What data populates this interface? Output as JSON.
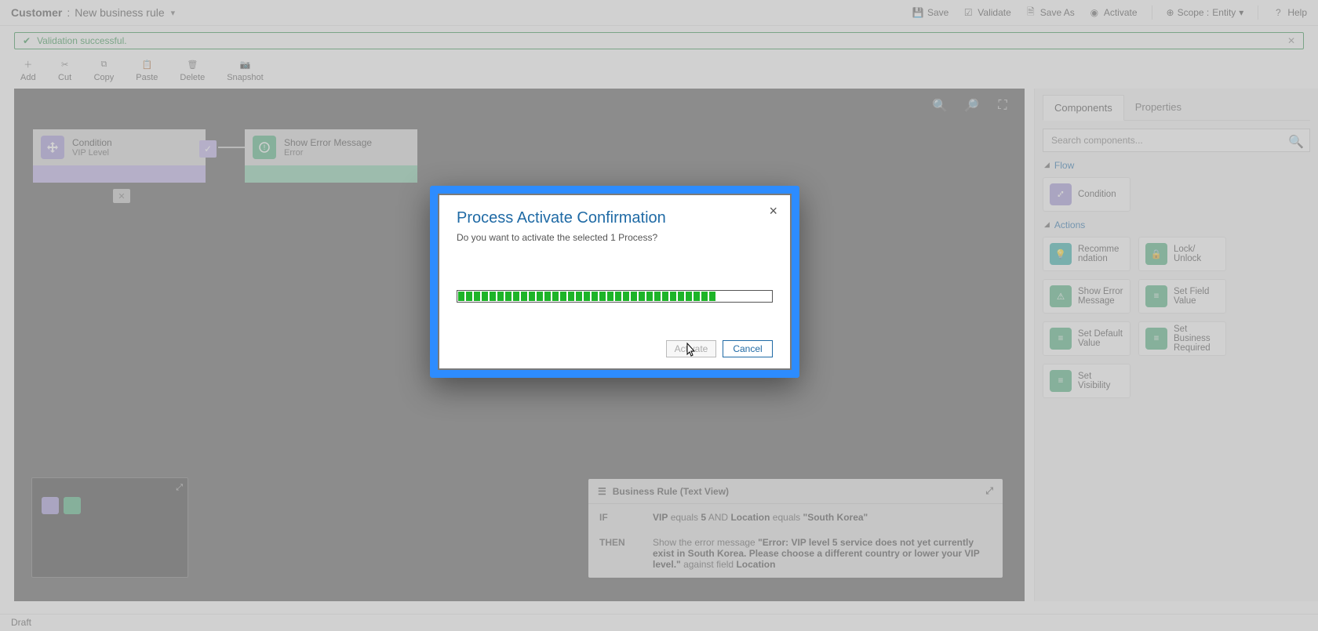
{
  "titlebar": {
    "entity": "Customer",
    "name": "New business rule",
    "actions": {
      "save": "Save",
      "validate": "Validate",
      "saveAs": "Save As",
      "activate": "Activate",
      "scope_label": "Scope :",
      "scope_value": "Entity",
      "help": "Help"
    }
  },
  "validation": {
    "message": "Validation successful."
  },
  "toolbar": {
    "add": "Add",
    "cut": "Cut",
    "copy": "Copy",
    "paste": "Paste",
    "delete": "Delete",
    "snapshot": "Snapshot"
  },
  "canvas": {
    "condition": {
      "title": "Condition",
      "subtitle": "VIP Level"
    },
    "error": {
      "title": "Show Error Message",
      "subtitle": "Error"
    }
  },
  "textview": {
    "title": "Business Rule (Text View)",
    "if_label": "IF",
    "then_label": "THEN",
    "if_field1": "VIP",
    "if_op1": "equals",
    "if_val1": "5",
    "if_join": "AND",
    "if_field2": "Location",
    "if_op2": "equals",
    "if_val2": "\"South Korea\"",
    "then_pre": "Show the error message",
    "then_msg": "\"Error: VIP level 5 service does not yet currently exist in South Korea. Please choose a different country or lower your VIP level.\"",
    "then_mid": "against field",
    "then_field": "Location"
  },
  "side": {
    "tabs": {
      "components": "Components",
      "properties": "Properties"
    },
    "search_placeholder": "Search components...",
    "flow_h": "Flow",
    "actions_h": "Actions",
    "flow": {
      "condition": "Condition"
    },
    "actions": {
      "recommendation": "Recommendation",
      "lock": "Lock/\nUnlock",
      "showerr": "Show Error Message",
      "setfield": "Set Field Value",
      "setdefault": "Set Default Value",
      "setreq": "Set Business Required",
      "setvis": "Set Visibility"
    }
  },
  "footer": {
    "status": "Draft"
  },
  "modal": {
    "title": "Process Activate Confirmation",
    "subtitle": "Do you want to activate the selected 1 Process?",
    "activate": "Activate",
    "cancel": "Cancel",
    "progress_pct": 75
  }
}
